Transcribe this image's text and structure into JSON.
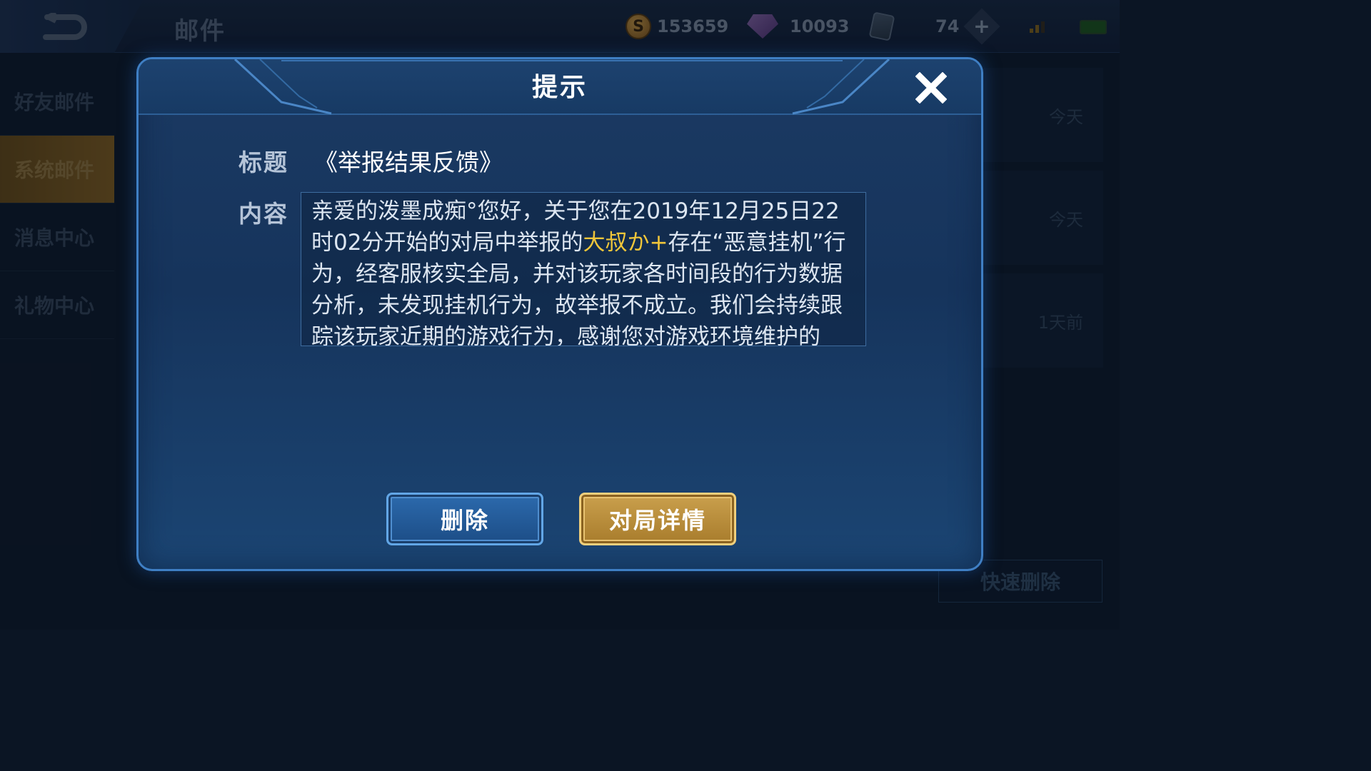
{
  "topbar": {
    "title": "邮件",
    "gold": "153659",
    "diamonds": "10093",
    "tickets": "74",
    "icons": [
      "back-icon",
      "coin-icon",
      "gem-icon",
      "card-icon",
      "plus-icon",
      "signal-icon",
      "battery-icon"
    ]
  },
  "sidebar": {
    "items": [
      {
        "label": "好友邮件"
      },
      {
        "label": "系统邮件"
      },
      {
        "label": "消息中心"
      },
      {
        "label": "礼物中心"
      }
    ],
    "active_index": 1
  },
  "mail_list": {
    "rows": [
      {
        "time": "今天"
      },
      {
        "time": "今天"
      },
      {
        "time": "1天前"
      }
    ],
    "quick_delete_label": "快速删除"
  },
  "dialog": {
    "title": "提示",
    "subject_label": "标题",
    "subject": "《举报结果反馈》",
    "content_label": "内容",
    "content_before": "亲爱的泼墨成痴°您好，关于您在2019年12月25日22时02分开始的对局中举报的",
    "content_highlight": "大叔か+",
    "content_after": "存在“恶意挂机”行为，经客服核实全局，并对该玩家各时间段的行为数据分析，未发现挂机行为，故举报不成立。我们会持续跟踪该玩家近期的游戏行为，感谢您对游戏环境维护的",
    "delete_label": "删除",
    "detail_label": "对局详情",
    "accent_gold": "#f0c63a",
    "accent_blue": "#3f7fc4"
  }
}
